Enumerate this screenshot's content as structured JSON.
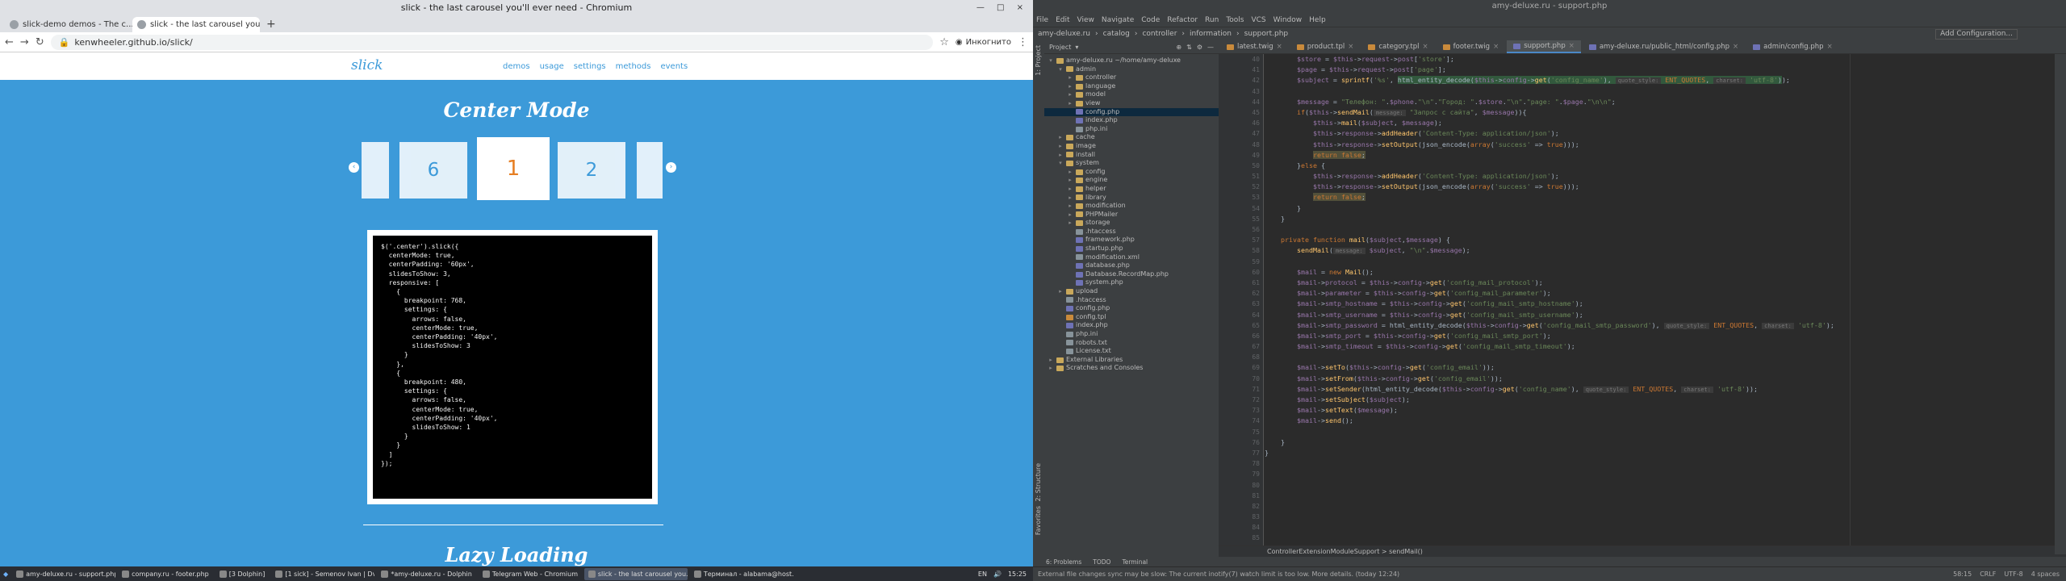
{
  "browser": {
    "window_title": "slick - the last carousel you'll ever need - Chromium",
    "window_controls": "— □ ×",
    "tabs": [
      {
        "title": "slick-demo demos - The c..."
      },
      {
        "title": "slick - the last carousel you'll..."
      }
    ],
    "new_tab": "+",
    "url": "kenwheeler.github.io/slick/",
    "incognito_label": "Инкогнито"
  },
  "site": {
    "logo": "slick",
    "nav_links": [
      "demos",
      "usage",
      "settings",
      "methods",
      "events"
    ],
    "section_title": "Center Mode",
    "slides": [
      "",
      "6",
      "1",
      "2",
      ""
    ],
    "prev_arrow": "‹",
    "next_arrow": "›",
    "code_lines": [
      "$('.center').slick({",
      "  centerMode: true,",
      "  centerPadding: '60px',",
      "  slidesToShow: 3,",
      "  responsive: [",
      "    {",
      "      breakpoint: 768,",
      "      settings: {",
      "        arrows: false,",
      "        centerMode: true,",
      "        centerPadding: '40px',",
      "        slidesToShow: 3",
      "      }",
      "    },",
      "    {",
      "      breakpoint: 480,",
      "      settings: {",
      "        arrows: false,",
      "        centerMode: true,",
      "        centerPadding: '40px',",
      "        slidesToShow: 1",
      "      }",
      "    }",
      "  ]",
      "});"
    ],
    "next_section_title": "Lazy Loading"
  },
  "ide": {
    "window_title": "amy-deluxe.ru - support.php",
    "menu": [
      "File",
      "Edit",
      "View",
      "Navigate",
      "Code",
      "Refactor",
      "Run",
      "Tools",
      "VCS",
      "Window",
      "Help"
    ],
    "breadcrumb": [
      "amy-deluxe.ru",
      "catalog",
      "controller",
      "information",
      "support.php"
    ],
    "add_configuration": "Add Configuration...",
    "left_strip": [
      "1: Project",
      "2: Structure",
      "Favorites"
    ],
    "project_header": "Project",
    "tree": [
      {
        "label": "amy-deluxe.ru  ~/home/amy-deluxe",
        "depth": 0,
        "type": "dir",
        "open": true
      },
      {
        "label": "admin",
        "depth": 1,
        "type": "dir",
        "open": true
      },
      {
        "label": "controller",
        "depth": 2,
        "type": "dir"
      },
      {
        "label": "language",
        "depth": 2,
        "type": "dir"
      },
      {
        "label": "model",
        "depth": 2,
        "type": "dir"
      },
      {
        "label": "view",
        "depth": 2,
        "type": "dir"
      },
      {
        "label": "config.php",
        "depth": 2,
        "type": "php",
        "selected": true
      },
      {
        "label": "index.php",
        "depth": 2,
        "type": "php"
      },
      {
        "label": "php.ini",
        "depth": 2,
        "type": "file"
      },
      {
        "label": "cache",
        "depth": 1,
        "type": "dir"
      },
      {
        "label": "image",
        "depth": 1,
        "type": "dir"
      },
      {
        "label": "install",
        "depth": 1,
        "type": "dir"
      },
      {
        "label": "system",
        "depth": 1,
        "type": "dir",
        "open": true
      },
      {
        "label": "config",
        "depth": 2,
        "type": "dir"
      },
      {
        "label": "engine",
        "depth": 2,
        "type": "dir"
      },
      {
        "label": "helper",
        "depth": 2,
        "type": "dir"
      },
      {
        "label": "library",
        "depth": 2,
        "type": "dir"
      },
      {
        "label": "modification",
        "depth": 2,
        "type": "dir"
      },
      {
        "label": "PHPMailer",
        "depth": 2,
        "type": "dir"
      },
      {
        "label": "storage",
        "depth": 2,
        "type": "dir"
      },
      {
        "label": ".htaccess",
        "depth": 2,
        "type": "file"
      },
      {
        "label": "framework.php",
        "depth": 2,
        "type": "php"
      },
      {
        "label": "startup.php",
        "depth": 2,
        "type": "php"
      },
      {
        "label": "modification.xml",
        "depth": 2,
        "type": "file"
      },
      {
        "label": "database.php",
        "depth": 2,
        "type": "php"
      },
      {
        "label": "Database.RecordMap.php",
        "depth": 2,
        "type": "php"
      },
      {
        "label": "system.php",
        "depth": 2,
        "type": "php"
      },
      {
        "label": "upload",
        "depth": 1,
        "type": "dir"
      },
      {
        "label": ".htaccess",
        "depth": 1,
        "type": "file"
      },
      {
        "label": "config.php",
        "depth": 1,
        "type": "php"
      },
      {
        "label": "config.tpl",
        "depth": 1,
        "type": "tpl"
      },
      {
        "label": "index.php",
        "depth": 1,
        "type": "php"
      },
      {
        "label": "php.ini",
        "depth": 1,
        "type": "file"
      },
      {
        "label": "robots.txt",
        "depth": 1,
        "type": "file"
      },
      {
        "label": "License.txt",
        "depth": 1,
        "type": "file"
      },
      {
        "label": "External Libraries",
        "depth": 0,
        "type": "dir"
      },
      {
        "label": "Scratches and Consoles",
        "depth": 0,
        "type": "dir"
      }
    ],
    "editor_tabs": [
      "latest.twig",
      "product.tpl",
      "category.tpl",
      "footer.twig",
      "support.php",
      "amy-deluxe.ru/public_html/config.php",
      "admin/config.php"
    ],
    "active_tab": "support.php",
    "line_numbers": [
      "40",
      "41",
      "42",
      "43",
      "44",
      "45",
      "46",
      "47",
      "48",
      "49",
      "50",
      "51",
      "52",
      "53",
      "54",
      "55",
      "56",
      "57",
      "58",
      "59",
      "60",
      "61",
      "62",
      "63",
      "64",
      "65",
      "66",
      "67",
      "68",
      "69",
      "70",
      "71",
      "72",
      "73",
      "74",
      "75",
      "76",
      "77",
      "78",
      "79",
      "80",
      "81",
      "82",
      "83",
      "84",
      "85"
    ],
    "code_breadcrumb": "ControllerExtensionModuleSupport  >  sendMail()",
    "bottom_tools": [
      "6: Problems",
      "TODO",
      "Terminal"
    ],
    "status_message": "External file changes sync may be slow: The current inotify(7) watch limit is too low. More details. (today 12:24)",
    "status_right": [
      "58:15",
      "CRLF",
      "UTF-8",
      "4 spaces"
    ]
  },
  "taskbar": {
    "items": [
      "amy-deluxe.ru - support.php",
      "company.ru - footer.php",
      "[3 Dolphin]",
      "[1 sick] - Semenov Ivan | Dve...",
      "*amy-deluxe.ru - Dolphin",
      "Telegram Web - Chromium",
      "slick - the last carousel you...",
      "Терминал - alabama@host..."
    ],
    "active_index": 6,
    "clock": "15:25",
    "lang": "EN"
  }
}
